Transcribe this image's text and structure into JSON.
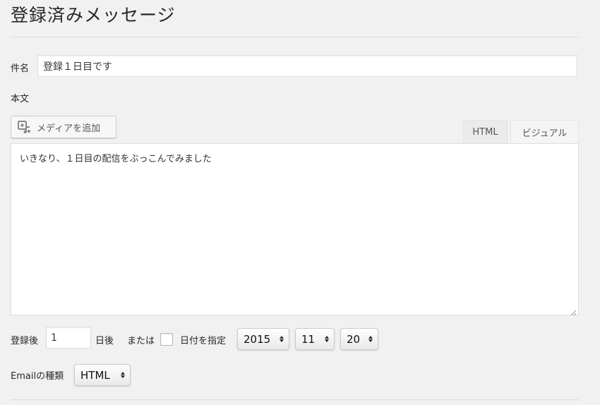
{
  "page": {
    "title": "登録済みメッセージ"
  },
  "subject": {
    "label": "件名",
    "value": "登録１日目です"
  },
  "body": {
    "label": "本文",
    "text": "いきなり、１日目の配信をぶっこんでみました"
  },
  "toolbar": {
    "add_media_label": "メディアを追加"
  },
  "tabs": [
    {
      "label": "HTML",
      "active": false
    },
    {
      "label": "ビジュアル",
      "active": true
    }
  ],
  "schedule": {
    "after_label": "登録後",
    "days_value": "1",
    "days_unit_label": "日後",
    "or_label": "または",
    "specify_date_label": "日付を指定",
    "specify_date_checked": false,
    "year": "2015",
    "month": "11",
    "day": "20"
  },
  "email_type": {
    "label": "Emailの種類",
    "value": "HTML"
  },
  "icons": {
    "add_media": "media-icon",
    "select_arrows": "updown-arrows-icon",
    "resize": "resize-grip-icon"
  },
  "colors": {
    "background": "#f1f1f1",
    "text": "#23282d",
    "border": "#dddddd"
  }
}
